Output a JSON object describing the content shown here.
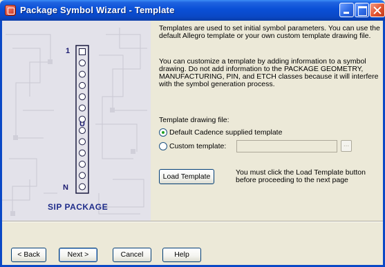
{
  "window": {
    "title": "Package Symbol Wizard - Template"
  },
  "illustration": {
    "pin_first": "1",
    "pin_last": "N",
    "package_name": "SIP PACKAGE",
    "pin_count_shown": 13
  },
  "content": {
    "intro": "Templates are used to set initial symbol parameters. You can use the default Allegro template or your own custom template drawing file.",
    "customize": "You can customize a template by adding information to a symbol drawing. Do not add information to the PACKAGE GEOMETRY, MANUFACTURING, PIN, and ETCH classes because it will interfere with the symbol generation process.",
    "template_label": "Template drawing file:",
    "option_default": "Default Cadence supplied template",
    "option_custom": "Custom template:",
    "selected_option": "default",
    "custom_value": "",
    "browse_label": "...",
    "load_button": "Load Template",
    "load_note": "You must click the Load Template button before proceeding to the next page"
  },
  "footer": {
    "back": "< Back",
    "next": "Next >",
    "cancel": "Cancel",
    "help": "Help"
  },
  "colors": {
    "titlebar": "#0a4fd6",
    "dialog_bg": "#ece9d8",
    "package_label": "#1e2c8a",
    "radio_dot": "#21a121"
  }
}
